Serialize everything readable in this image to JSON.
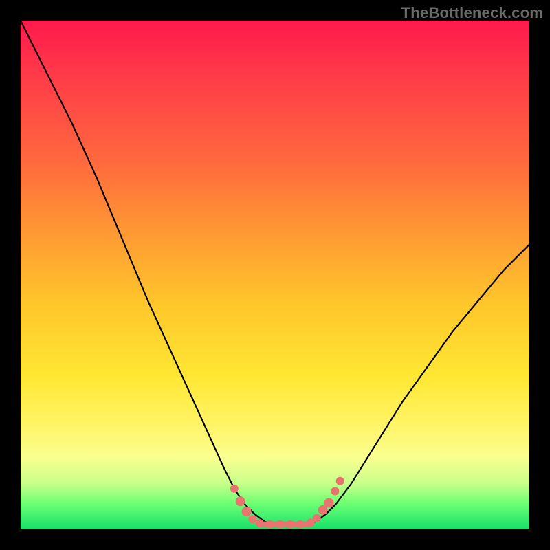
{
  "watermark": "TheBottleneck.com",
  "colors": {
    "background": "#000000",
    "curve": "#000000",
    "marker": "#e8736f",
    "gradient_top": "#ff1a4d",
    "gradient_bottom": "#16e06a"
  },
  "chart_data": {
    "type": "line",
    "title": "",
    "xlabel": "",
    "ylabel": "",
    "xlim": [
      0,
      100
    ],
    "ylim": [
      0,
      100
    ],
    "grid": false,
    "legend": false,
    "series": [
      {
        "name": "bottleneck-curve",
        "x": [
          0,
          5,
          10,
          15,
          20,
          25,
          30,
          35,
          40,
          42,
          44,
          46,
          48,
          50,
          52,
          54,
          56,
          58,
          60,
          62,
          65,
          70,
          75,
          80,
          85,
          90,
          95,
          100
        ],
        "y": [
          100,
          90,
          80,
          69,
          57,
          45,
          34,
          23,
          12,
          8,
          5,
          3,
          1.5,
          1,
          1,
          1,
          1,
          1.5,
          3,
          5,
          9,
          17,
          25,
          32,
          39,
          45,
          51,
          56
        ]
      }
    ],
    "markers": {
      "name": "flat-region-dots",
      "color": "#e8736f",
      "points": [
        {
          "x": 42.0,
          "y": 8.0,
          "r": 6
        },
        {
          "x": 43.2,
          "y": 5.5,
          "r": 7
        },
        {
          "x": 44.4,
          "y": 3.5,
          "r": 7
        },
        {
          "x": 45.6,
          "y": 2.0,
          "r": 6
        },
        {
          "x": 47.0,
          "y": 1.2,
          "r": 6
        },
        {
          "x": 49.0,
          "y": 1.0,
          "r": 6
        },
        {
          "x": 51.0,
          "y": 1.0,
          "r": 6
        },
        {
          "x": 53.0,
          "y": 1.0,
          "r": 6
        },
        {
          "x": 55.0,
          "y": 1.0,
          "r": 6
        },
        {
          "x": 57.0,
          "y": 1.3,
          "r": 6
        },
        {
          "x": 58.2,
          "y": 2.2,
          "r": 6
        },
        {
          "x": 59.4,
          "y": 3.8,
          "r": 7
        },
        {
          "x": 60.6,
          "y": 5.2,
          "r": 7
        },
        {
          "x": 61.8,
          "y": 7.5,
          "r": 6
        },
        {
          "x": 62.8,
          "y": 9.5,
          "r": 6
        }
      ]
    },
    "flat_segment": {
      "x0": 47,
      "x1": 57,
      "y": 1.0
    }
  }
}
